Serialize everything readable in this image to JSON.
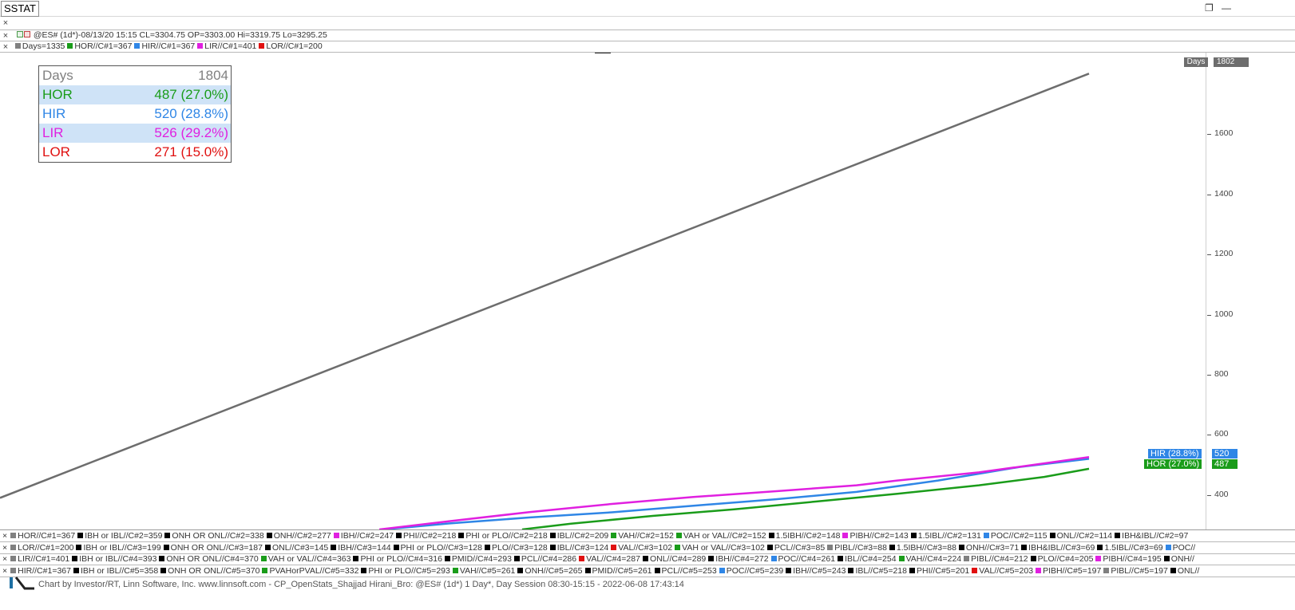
{
  "window": {
    "title": "SSTAT",
    "restore_icon": "restore-icon",
    "minimize_icon": "minimize-icon"
  },
  "header": {
    "instrument_line": "@ES# (1d*)-08/13/20 15:15 CL=3304.75 OP=3303.00 Hi=3319.75 Lo=3295.25",
    "legend_items": [
      {
        "label": "Days=1335",
        "color": "#808080"
      },
      {
        "label": "HOR//C#1=367",
        "color": "#1a9c1a"
      },
      {
        "label": "HIR//C#1=367",
        "color": "#2f86e6"
      },
      {
        "label": "LIR//C#1=401",
        "color": "#e020e0"
      },
      {
        "label": "LOR//C#1=200",
        "color": "#e01010"
      }
    ]
  },
  "stats_table": [
    {
      "label": "Days",
      "value": "1804",
      "color": "#808080",
      "bg": "#ffffff"
    },
    {
      "label": "HOR",
      "value": "487 (27.0%)",
      "color": "#1a9c1a",
      "bg": "#cfe3f7"
    },
    {
      "label": "HIR",
      "value": "520 (28.8%)",
      "color": "#2f86e6",
      "bg": "#ffffff"
    },
    {
      "label": "LIR",
      "value": "526 (29.2%)",
      "color": "#e020e0",
      "bg": "#cfe3f7"
    },
    {
      "label": "LOR",
      "value": "271 (15.0%)",
      "color": "#e01010",
      "bg": "#ffffff"
    }
  ],
  "axis_tags": {
    "days_label": "Days",
    "days_value": "1802",
    "hir_label": "HIR (28.8%)",
    "hir_value": "520",
    "hor_label": "HOR (27.0%)",
    "hor_value": "487"
  },
  "chart_data": {
    "type": "line",
    "x": [
      0,
      1335
    ],
    "xlim": [
      0,
      1335
    ],
    "ylim": [
      285,
      1840
    ],
    "ytick_labels": [
      "400",
      "600",
      "800",
      "1000",
      "1200",
      "1400",
      "1600"
    ],
    "series": [
      {
        "name": "Days",
        "color": "#6d6d6d",
        "points": [
          [
            0,
            390
          ],
          [
            1335,
            1802
          ]
        ]
      },
      {
        "name": "HOR",
        "color": "#1a9c1a",
        "points": [
          [
            640,
            285
          ],
          [
            700,
            304
          ],
          [
            800,
            330
          ],
          [
            900,
            352
          ],
          [
            1000,
            378
          ],
          [
            1100,
            404
          ],
          [
            1200,
            432
          ],
          [
            1280,
            460
          ],
          [
            1335,
            487
          ]
        ]
      },
      {
        "name": "HIR",
        "color": "#2f86e6",
        "points": [
          [
            470,
            285
          ],
          [
            550,
            305
          ],
          [
            650,
            325
          ],
          [
            750,
            342
          ],
          [
            850,
            364
          ],
          [
            950,
            385
          ],
          [
            1050,
            410
          ],
          [
            1150,
            448
          ],
          [
            1250,
            493
          ],
          [
            1335,
            520
          ]
        ]
      },
      {
        "name": "LIR",
        "color": "#e020e0",
        "points": [
          [
            465,
            285
          ],
          [
            550,
            312
          ],
          [
            650,
            343
          ],
          [
            750,
            370
          ],
          [
            850,
            393
          ],
          [
            950,
            412
          ],
          [
            1050,
            432
          ],
          [
            1100,
            448
          ],
          [
            1200,
            475
          ],
          [
            1280,
            505
          ],
          [
            1335,
            526
          ]
        ]
      },
      {
        "name": "LOR",
        "color": "#e01010",
        "points": []
      }
    ]
  },
  "footer_rows": [
    [
      {
        "label": "HOR//C#1=367",
        "color": "#808080"
      },
      {
        "label": "IBH or IBL//C#2=359",
        "color": "#000000"
      },
      {
        "label": "ONH OR ONL//C#2=338",
        "color": "#000000"
      },
      {
        "label": "ONH//C#2=277",
        "color": "#000000"
      },
      {
        "label": "IBH//C#2=247",
        "color": "#e020e0"
      },
      {
        "label": "PHI//C#2=218",
        "color": "#000000"
      },
      {
        "label": "PHI or PLO//C#2=218",
        "color": "#000000"
      },
      {
        "label": "IBL//C#2=209",
        "color": "#000000"
      },
      {
        "label": "VAH//C#2=152",
        "color": "#1a9c1a"
      },
      {
        "label": "VAH or VAL//C#2=152",
        "color": "#1a9c1a"
      },
      {
        "label": "1.5IBH//C#2=148",
        "color": "#000000"
      },
      {
        "label": "PIBH//C#2=143",
        "color": "#e020e0"
      },
      {
        "label": "1.5IBL//C#2=131",
        "color": "#000000"
      },
      {
        "label": "POC//C#2=115",
        "color": "#2f86e6"
      },
      {
        "label": "ONL//C#2=114",
        "color": "#000000"
      },
      {
        "label": "IBH&IBL//C#2=97",
        "color": "#000000"
      }
    ],
    [
      {
        "label": "LOR//C#1=200",
        "color": "#808080"
      },
      {
        "label": "IBH or IBL//C#3=199",
        "color": "#000000"
      },
      {
        "label": "ONH OR ONL//C#3=187",
        "color": "#000000"
      },
      {
        "label": "ONL//C#3=145",
        "color": "#000000"
      },
      {
        "label": "IBH//C#3=144",
        "color": "#000000"
      },
      {
        "label": "PHI or PLO//C#3=128",
        "color": "#000000"
      },
      {
        "label": "PLO//C#3=128",
        "color": "#000000"
      },
      {
        "label": "IBL//C#3=124",
        "color": "#000000"
      },
      {
        "label": "VAL//C#3=102",
        "color": "#e01010"
      },
      {
        "label": "VAH or VAL//C#3=102",
        "color": "#1a9c1a"
      },
      {
        "label": "PCL//C#3=85",
        "color": "#000000"
      },
      {
        "label": "PIBL//C#3=88",
        "color": "#808080"
      },
      {
        "label": "1.5IBH//C#3=88",
        "color": "#000000"
      },
      {
        "label": "ONH//C#3=71",
        "color": "#000000"
      },
      {
        "label": "IBH&IBL//C#3=69",
        "color": "#000000"
      },
      {
        "label": "1.5IBL//C#3=69",
        "color": "#000000"
      },
      {
        "label": "POC//",
        "color": "#2f86e6"
      }
    ],
    [
      {
        "label": "LIR//C#1=401",
        "color": "#808080"
      },
      {
        "label": "IBH or IBL//C#4=393",
        "color": "#000000"
      },
      {
        "label": "ONH OR ONL//C#4=370",
        "color": "#000000"
      },
      {
        "label": "VAH or VAL//C#4=363",
        "color": "#1a9c1a"
      },
      {
        "label": "PHI or PLO//C#4=316",
        "color": "#000000"
      },
      {
        "label": "PMID//C#4=293",
        "color": "#000000"
      },
      {
        "label": "PCL//C#4=286",
        "color": "#000000"
      },
      {
        "label": "VAL//C#4=287",
        "color": "#e01010"
      },
      {
        "label": "ONL//C#4=289",
        "color": "#000000"
      },
      {
        "label": "IBH//C#4=272",
        "color": "#000000"
      },
      {
        "label": "POC//C#4=261",
        "color": "#2f86e6"
      },
      {
        "label": "IBL//C#4=254",
        "color": "#000000"
      },
      {
        "label": "VAH//C#4=224",
        "color": "#1a9c1a"
      },
      {
        "label": "PIBL//C#4=212",
        "color": "#808080"
      },
      {
        "label": "PLO//C#4=205",
        "color": "#000000"
      },
      {
        "label": "PIBH//C#4=195",
        "color": "#e020e0"
      },
      {
        "label": "ONH//",
        "color": "#000000"
      }
    ],
    [
      {
        "label": "HIR//C#1=367",
        "color": "#808080"
      },
      {
        "label": "IBH or IBL//C#5=358",
        "color": "#000000"
      },
      {
        "label": "ONH OR ONL//C#5=370",
        "color": "#000000"
      },
      {
        "label": "PVAHorPVAL//C#5=332",
        "color": "#1a9c1a"
      },
      {
        "label": "PHI or PLO//C#5=293",
        "color": "#000000"
      },
      {
        "label": "VAH//C#5=261",
        "color": "#1a9c1a"
      },
      {
        "label": "ONH//C#5=265",
        "color": "#000000"
      },
      {
        "label": "PMID//C#5=261",
        "color": "#000000"
      },
      {
        "label": "PCL//C#5=253",
        "color": "#000000"
      },
      {
        "label": "POC//C#5=239",
        "color": "#2f86e6"
      },
      {
        "label": "IBH//C#5=243",
        "color": "#000000"
      },
      {
        "label": "IBL//C#5=218",
        "color": "#000000"
      },
      {
        "label": "PHI//C#5=201",
        "color": "#000000"
      },
      {
        "label": "VAL//C#5=203",
        "color": "#e01010"
      },
      {
        "label": "PIBH//C#5=197",
        "color": "#e020e0"
      },
      {
        "label": "PIBL//C#5=197",
        "color": "#808080"
      },
      {
        "label": "ONL//",
        "color": "#000000"
      }
    ]
  ],
  "credit": "Chart by Investor/RT, Linn Software, Inc. www.linnsoft.com - CP_OpenStats_Shajjad Hirani_Bro: @ES# (1d*) 1 Day*, Day Session 08:30-15:15 - 2022-06-08 17:43:14",
  "logo_icon": "linn-software-logo-icon"
}
